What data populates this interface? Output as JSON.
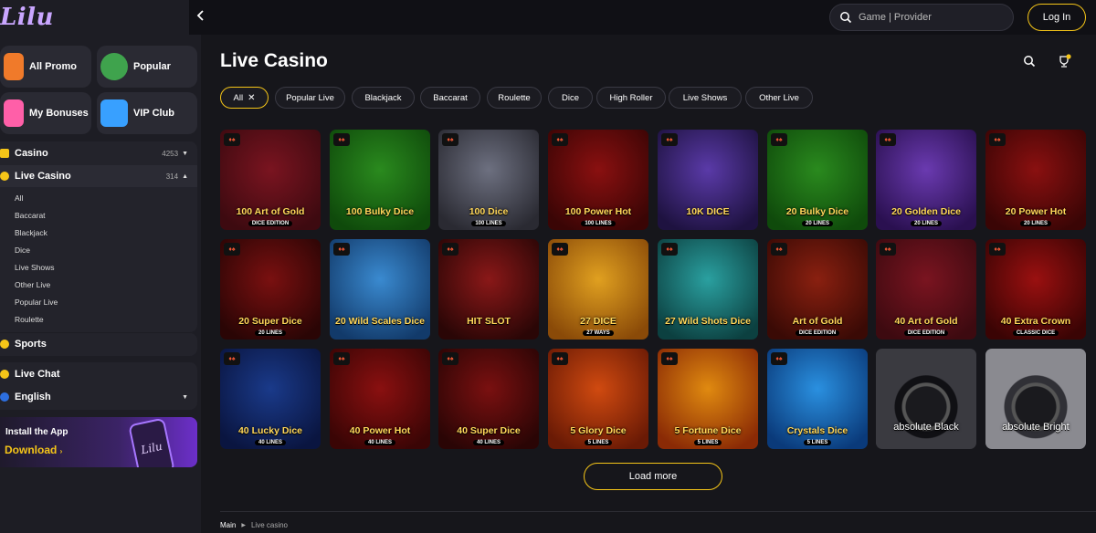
{
  "app": {
    "logo": "Lilu"
  },
  "topbar": {
    "back_icon": "chevron-left-icon",
    "search_placeholder": "Game | Provider",
    "login_label": "Log In"
  },
  "sidebar": {
    "promo": [
      {
        "label": "All Promo",
        "icon": "rocket-icon",
        "color": "#f07a2a"
      },
      {
        "label": "Popular",
        "icon": "wheel-icon",
        "color": "#3fa34d"
      },
      {
        "label": "My Bonuses",
        "icon": "bag-icon",
        "color": "#ff5fa8"
      },
      {
        "label": "VIP Club",
        "icon": "gift-icon",
        "color": "#38a0ff"
      }
    ],
    "casino": {
      "label": "Casino",
      "count": "4253"
    },
    "live_casino": {
      "label": "Live Casino",
      "count": "314"
    },
    "live_items": [
      "All",
      "Baccarat",
      "Blackjack",
      "Dice",
      "Live Shows",
      "Other Live",
      "Popular Live",
      "Roulette"
    ],
    "sports_label": "Sports",
    "live_chat_label": "Live Chat",
    "language_label": "English",
    "install": {
      "title": "Install the App",
      "download": "Download",
      "phone_logo": "Lilu"
    }
  },
  "main": {
    "title": "Live Casino",
    "filters": [
      {
        "label": "All",
        "active": true
      },
      {
        "label": "Popular Live",
        "active": false
      },
      {
        "label": "Blackjack",
        "active": false
      },
      {
        "label": "Baccarat",
        "active": false
      },
      {
        "label": "Roulette",
        "active": false
      },
      {
        "label": "Dice",
        "active": false
      },
      {
        "label": "High Roller",
        "active": false
      },
      {
        "label": "Live Shows",
        "active": false
      },
      {
        "label": "Other Live",
        "active": false
      }
    ],
    "games": [
      {
        "name": "100 Art of Gold",
        "sub": "DICE EDITION",
        "bg": "#7a1420",
        "bg2": "#3d0a10"
      },
      {
        "name": "100 Bulky Dice",
        "sub": "",
        "bg": "#2a8a1e",
        "bg2": "#0f4a0b"
      },
      {
        "name": "100 Dice",
        "sub": "100 LINES",
        "bg": "#6d7080",
        "bg2": "#2a2a32"
      },
      {
        "name": "100 Power Hot",
        "sub": "100 LINES",
        "bg": "#8a1010",
        "bg2": "#3a0505"
      },
      {
        "name": "10K DICE",
        "sub": "",
        "bg": "#5a3aa8",
        "bg2": "#1e1240"
      },
      {
        "name": "20 Bulky Dice",
        "sub": "20 LINES",
        "bg": "#2a8a1e",
        "bg2": "#0f4a0b"
      },
      {
        "name": "20 Golden Dice",
        "sub": "20 LINES",
        "bg": "#6a3ab0",
        "bg2": "#2a1050"
      },
      {
        "name": "20 Power Hot",
        "sub": "20 LINES",
        "bg": "#8a1010",
        "bg2": "#3a0505"
      },
      {
        "name": "20 Super Dice",
        "sub": "20 LINES",
        "bg": "#7a1010",
        "bg2": "#2a0505"
      },
      {
        "name": "20 Wild Scales Dice",
        "sub": "",
        "bg": "#3a8ad0",
        "bg2": "#123a6a"
      },
      {
        "name": "HIT SLOT",
        "sub": "",
        "bg": "#8a1818",
        "bg2": "#2a0606"
      },
      {
        "name": "27 DICE",
        "sub": "27 WAYS",
        "bg": "#e0a020",
        "bg2": "#8a4a08"
      },
      {
        "name": "27 Wild Shots Dice",
        "sub": "",
        "bg": "#2aa0a0",
        "bg2": "#0c4040"
      },
      {
        "name": "Art of Gold",
        "sub": "DICE EDITION",
        "bg": "#8a2010",
        "bg2": "#3a0a05"
      },
      {
        "name": "40 Art of Gold",
        "sub": "DICE EDITION",
        "bg": "#7a1420",
        "bg2": "#3d0a10"
      },
      {
        "name": "40 Extra Crown",
        "sub": "CLASSIC DICE",
        "bg": "#9a1010",
        "bg2": "#3a0404"
      },
      {
        "name": "40 Lucky Dice",
        "sub": "40 LINES",
        "bg": "#1a3a8a",
        "bg2": "#0a1540"
      },
      {
        "name": "40 Power Hot",
        "sub": "40 LINES",
        "bg": "#8a1010",
        "bg2": "#3a0505"
      },
      {
        "name": "40 Super Dice",
        "sub": "40 LINES",
        "bg": "#7a1010",
        "bg2": "#2a0505"
      },
      {
        "name": "5 Glory Dice",
        "sub": "5 LINES",
        "bg": "#d04a10",
        "bg2": "#6a1a05"
      },
      {
        "name": "5 Fortune Dice",
        "sub": "5 LINES",
        "bg": "#e08a10",
        "bg2": "#8a2a05"
      },
      {
        "name": "Crystals Dice",
        "sub": "5 LINES",
        "bg": "#2a90e0",
        "bg2": "#0a3a7a"
      },
      {
        "name": "absolute Black",
        "sub": "",
        "bg": "#3a3a40",
        "bg2": "#101014",
        "roulette": true
      },
      {
        "name": "absolute Bright",
        "sub": "",
        "bg": "#8a8a90",
        "bg2": "#303036",
        "roulette": true
      }
    ],
    "load_more_label": "Load more",
    "breadcrumb": {
      "home": "Main",
      "current": "Live casino"
    }
  }
}
